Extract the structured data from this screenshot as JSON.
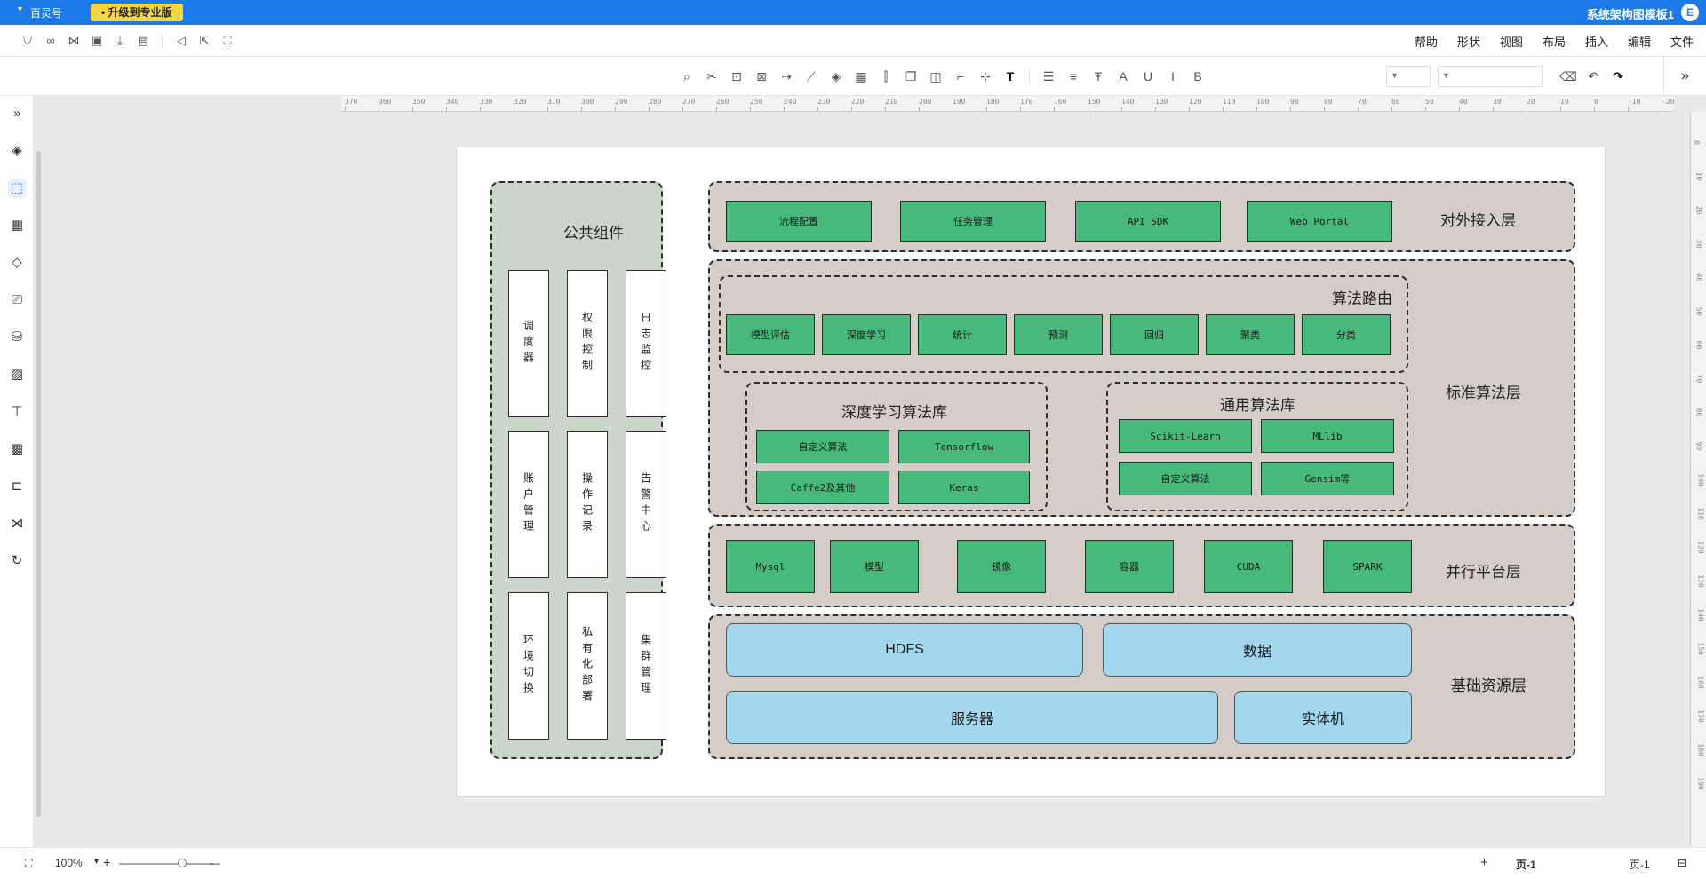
{
  "titlebar": {
    "doc_title": "系统架构图模板1",
    "upgrade_label": "• 升级到专业版",
    "user_name": "百灵号",
    "user_caret": "▾",
    "logo_char": "E"
  },
  "menu": {
    "items": [
      "文件",
      "编辑",
      "插入",
      "布局",
      "视图",
      "形状",
      "帮助"
    ]
  },
  "toolbar": {
    "expand_icon": "»",
    "font_value": "▾",
    "size_value": "▾"
  },
  "statusbar": {
    "page_label_left": "页-1",
    "page_tab": "页-1",
    "add_page": "+",
    "zoom_minus": "—",
    "zoom_value": "100%",
    "zoom_plus": "+",
    "zoom_caret": "▾",
    "fit_icon": "⛶"
  },
  "ruler": {
    "h_ticks": [
      "370",
      "360",
      "350",
      "340",
      "330",
      "320",
      "310",
      "300",
      "290",
      "280",
      "270",
      "260",
      "250",
      "240",
      "230",
      "220",
      "210",
      "200",
      "190",
      "180",
      "170",
      "160",
      "150",
      "140",
      "130",
      "120",
      "110",
      "100",
      "90",
      "80",
      "70",
      "60",
      "50",
      "40",
      "30",
      "20",
      "10",
      "0",
      "-10",
      "-20"
    ],
    "v_ticks": [
      "0",
      "10",
      "20",
      "30",
      "40",
      "50",
      "60",
      "70",
      "80",
      "90",
      "100",
      "110",
      "120",
      "130",
      "140",
      "150",
      "160",
      "170",
      "180",
      "190"
    ]
  },
  "diagram": {
    "common": {
      "title": "公共组件",
      "items": [
        "日志监控",
        "权限控制",
        "调度器",
        "告警中心",
        "操作记录",
        "账户管理",
        "集群管理",
        "私有化部署",
        "环境切换"
      ]
    },
    "access_layer": {
      "title": "对外接入层",
      "items": [
        "Web Portal",
        "API SDK",
        "任务管理",
        "流程配置"
      ]
    },
    "algo_layer": {
      "title": "标准算法层",
      "routing": {
        "title": "算法路由",
        "items": [
          "分类",
          "聚类",
          "回归",
          "预测",
          "统计",
          "深度学习",
          "模型评估"
        ]
      },
      "general_lib": {
        "title": "通用算法库",
        "items": [
          "MLlib",
          "Scikit-Learn",
          "Gensim等",
          "自定义算法"
        ]
      },
      "dl_lib": {
        "title": "深度学习算法库",
        "items": [
          "Tensorflow",
          "自定义算法",
          "Keras",
          "Caffe2及其他"
        ]
      }
    },
    "parallel_layer": {
      "title": "并行平台层",
      "items": [
        "SPARK",
        "CUDA",
        "容器",
        "镜像",
        "模型",
        "Mysql"
      ]
    },
    "base_layer": {
      "title": "基础资源层",
      "items": [
        "数据",
        "HDFS",
        "实体机",
        "服务器"
      ]
    }
  }
}
